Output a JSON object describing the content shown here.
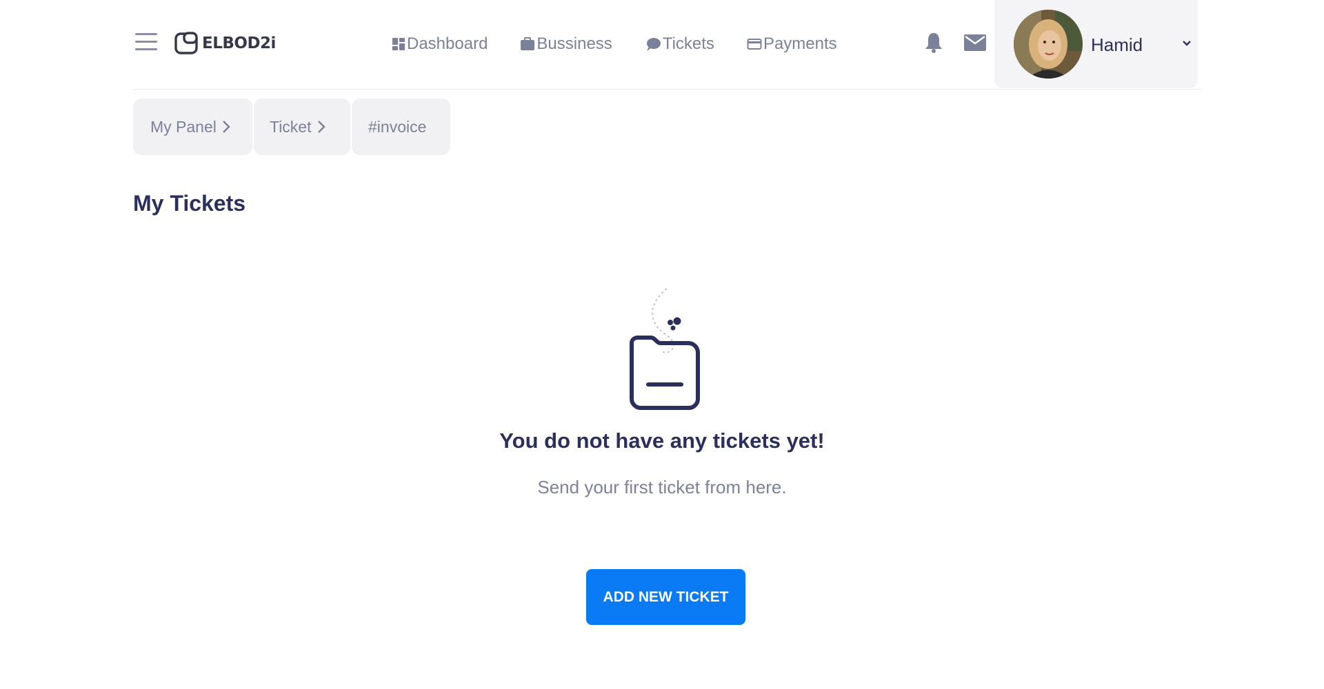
{
  "brand": {
    "name": "ELBOD2i"
  },
  "nav": {
    "dashboard": "Dashboard",
    "business": "Bussiness",
    "tickets": "Tickets",
    "payments": "Payments"
  },
  "user": {
    "name": "Hamid"
  },
  "breadcrumbs": [
    "My Panel",
    "Ticket",
    "#invoice"
  ],
  "page": {
    "title": "My Tickets"
  },
  "empty_state": {
    "title": "You do not have any tickets yet!",
    "subtitle": "Send your first ticket from here.",
    "button_label": "ADD NEW TICKET"
  },
  "colors": {
    "primary": "#0a7bf5",
    "heading": "#2a2f5b",
    "muted": "#7c819a"
  }
}
